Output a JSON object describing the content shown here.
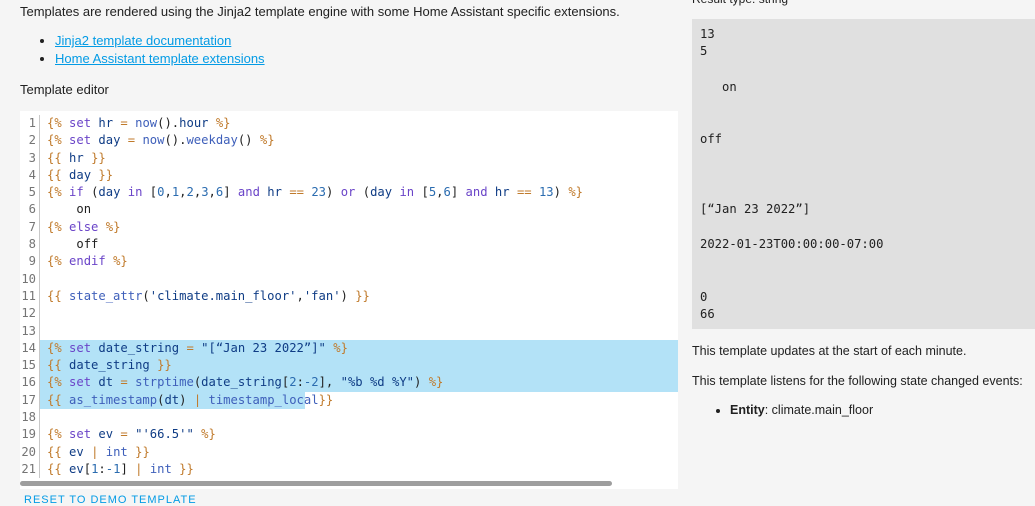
{
  "intro": "Templates are rendered using the Jinja2 template engine with some Home Assistant specific extensions.",
  "links": [
    "Jinja2 template documentation",
    "Home Assistant template extensions"
  ],
  "editor_label": "Template editor",
  "line_numbers": [
    "1",
    "2",
    "3",
    "4",
    "5",
    "6",
    "7",
    "8",
    "9",
    "10",
    "11",
    "12",
    "13",
    "14",
    "15",
    "16",
    "17",
    "18",
    "19",
    "20",
    "21"
  ],
  "reset_button": "RESET TO DEMO TEMPLATE",
  "result_type": "Result type: string",
  "result_lines": [
    "13",
    "5",
    "on",
    "off",
    "[“Jan 23 2022”]",
    "2022-01-23T00:00:00-07:00",
    "0",
    "66"
  ],
  "info": {
    "updates": "This template updates at the start of each minute.",
    "listens": "This template listens for the following state changed events:",
    "entity_label": "Entity",
    "entity_value": ": climate.main_floor"
  },
  "colors": {
    "link": "#039be5",
    "selection": "#b3e2f7",
    "result_bg": "#e0e0e0"
  }
}
